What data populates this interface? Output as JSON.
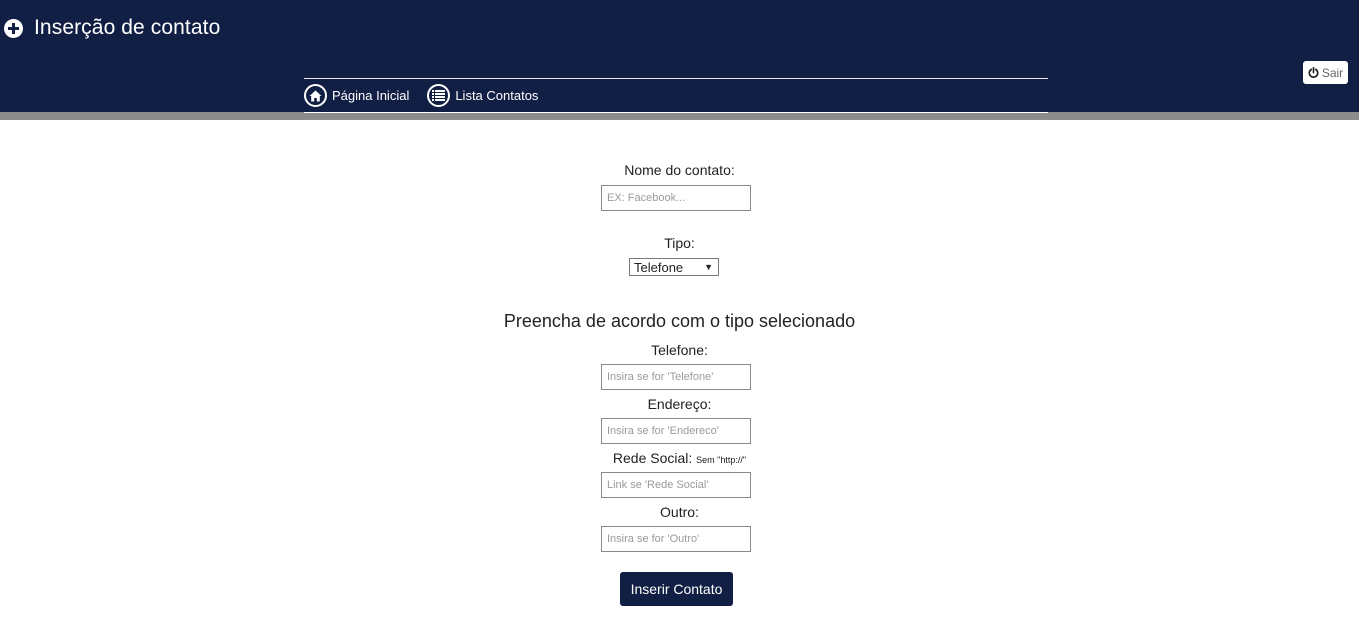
{
  "header": {
    "title": "Inserção de contato",
    "title_icon": "plus-circle-icon",
    "logout_label": "Sair",
    "logout_icon": "power-icon",
    "colors": {
      "header_bg": "#111f44",
      "strip": "#8c8c8c"
    }
  },
  "nav": {
    "items": [
      {
        "label": "Página Inicial",
        "icon": "home-icon"
      },
      {
        "label": "Lista Contatos",
        "icon": "list-icon"
      }
    ]
  },
  "form": {
    "name_label": "Nome do contato:",
    "name_placeholder": "EX: Facebook...",
    "type_label": "Tipo:",
    "type_selected": "Telefone",
    "section_title": "Preencha de acordo com o tipo selecionado",
    "phone_label": "Telefone:",
    "phone_placeholder": "Insira se for 'Telefone'",
    "address_label": "Endereço:",
    "address_placeholder": "Insira se for 'Endereco'",
    "social_label": "Rede Social:",
    "social_hint": "Sem \"http://\"",
    "social_placeholder": "Link se 'Rede Social'",
    "other_label": "Outro:",
    "other_placeholder": "Insira se for 'Outro'",
    "submit_label": "Inserir Contato"
  }
}
